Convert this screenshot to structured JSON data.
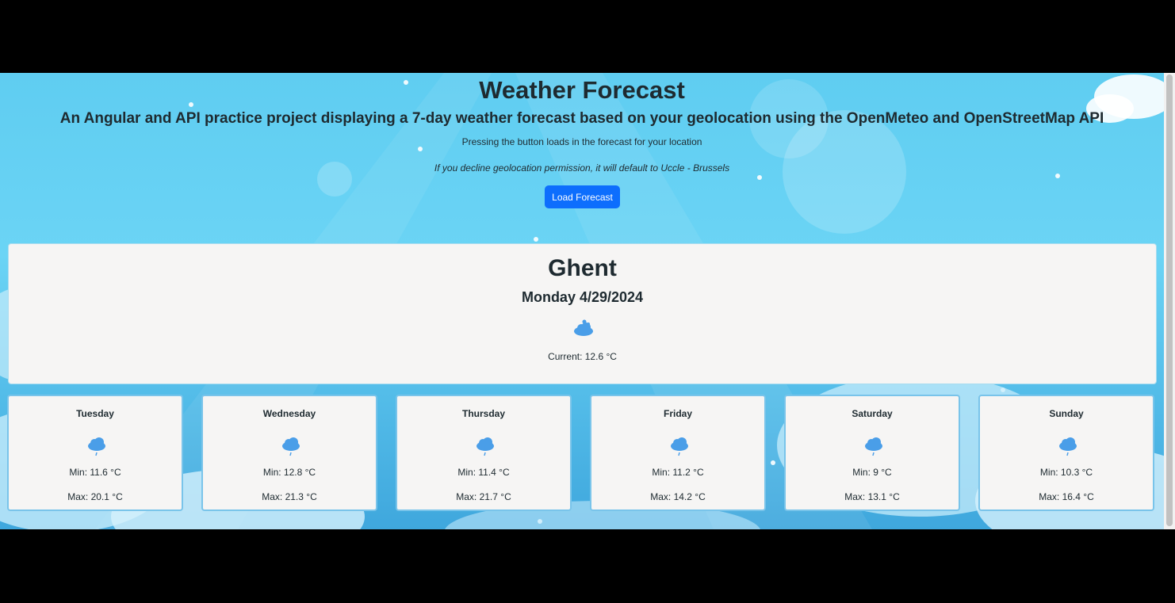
{
  "header": {
    "title": "Weather Forecast",
    "subtitle": "An Angular and API practice project displaying a 7-day weather forecast based on your geolocation using the OpenMeteo and OpenStreetMap API",
    "hint": "Pressing the button loads in the forecast for your location",
    "note": "If you decline geolocation permission, it will default to Uccle - Brussels",
    "load_button": "Load Forecast"
  },
  "today": {
    "city": "Ghent",
    "date": "Monday 4/29/2024",
    "icon": "partly-cloudy-icon",
    "current": "Current: 12.6 °C"
  },
  "days": [
    {
      "name": "Tuesday",
      "icon": "rain-cloud-icon",
      "min": "Min: 11.6 °C",
      "max": "Max: 20.1 °C"
    },
    {
      "name": "Wednesday",
      "icon": "rain-cloud-icon",
      "min": "Min: 12.8 °C",
      "max": "Max: 21.3 °C"
    },
    {
      "name": "Thursday",
      "icon": "rain-cloud-icon",
      "min": "Min: 11.4 °C",
      "max": "Max: 21.7 °C"
    },
    {
      "name": "Friday",
      "icon": "rain-cloud-icon",
      "min": "Min: 11.2 °C",
      "max": "Max: 14.2 °C"
    },
    {
      "name": "Saturday",
      "icon": "rain-cloud-icon",
      "min": "Min: 9 °C",
      "max": "Max: 13.1 °C"
    },
    {
      "name": "Sunday",
      "icon": "rain-cloud-icon",
      "min": "Min: 10.3 °C",
      "max": "Max: 16.4 °C"
    }
  ],
  "colors": {
    "sky": "#5fcdf1",
    "button": "#0d6efd",
    "card": "#f6f5f4",
    "icon": "#4a9ee8"
  }
}
